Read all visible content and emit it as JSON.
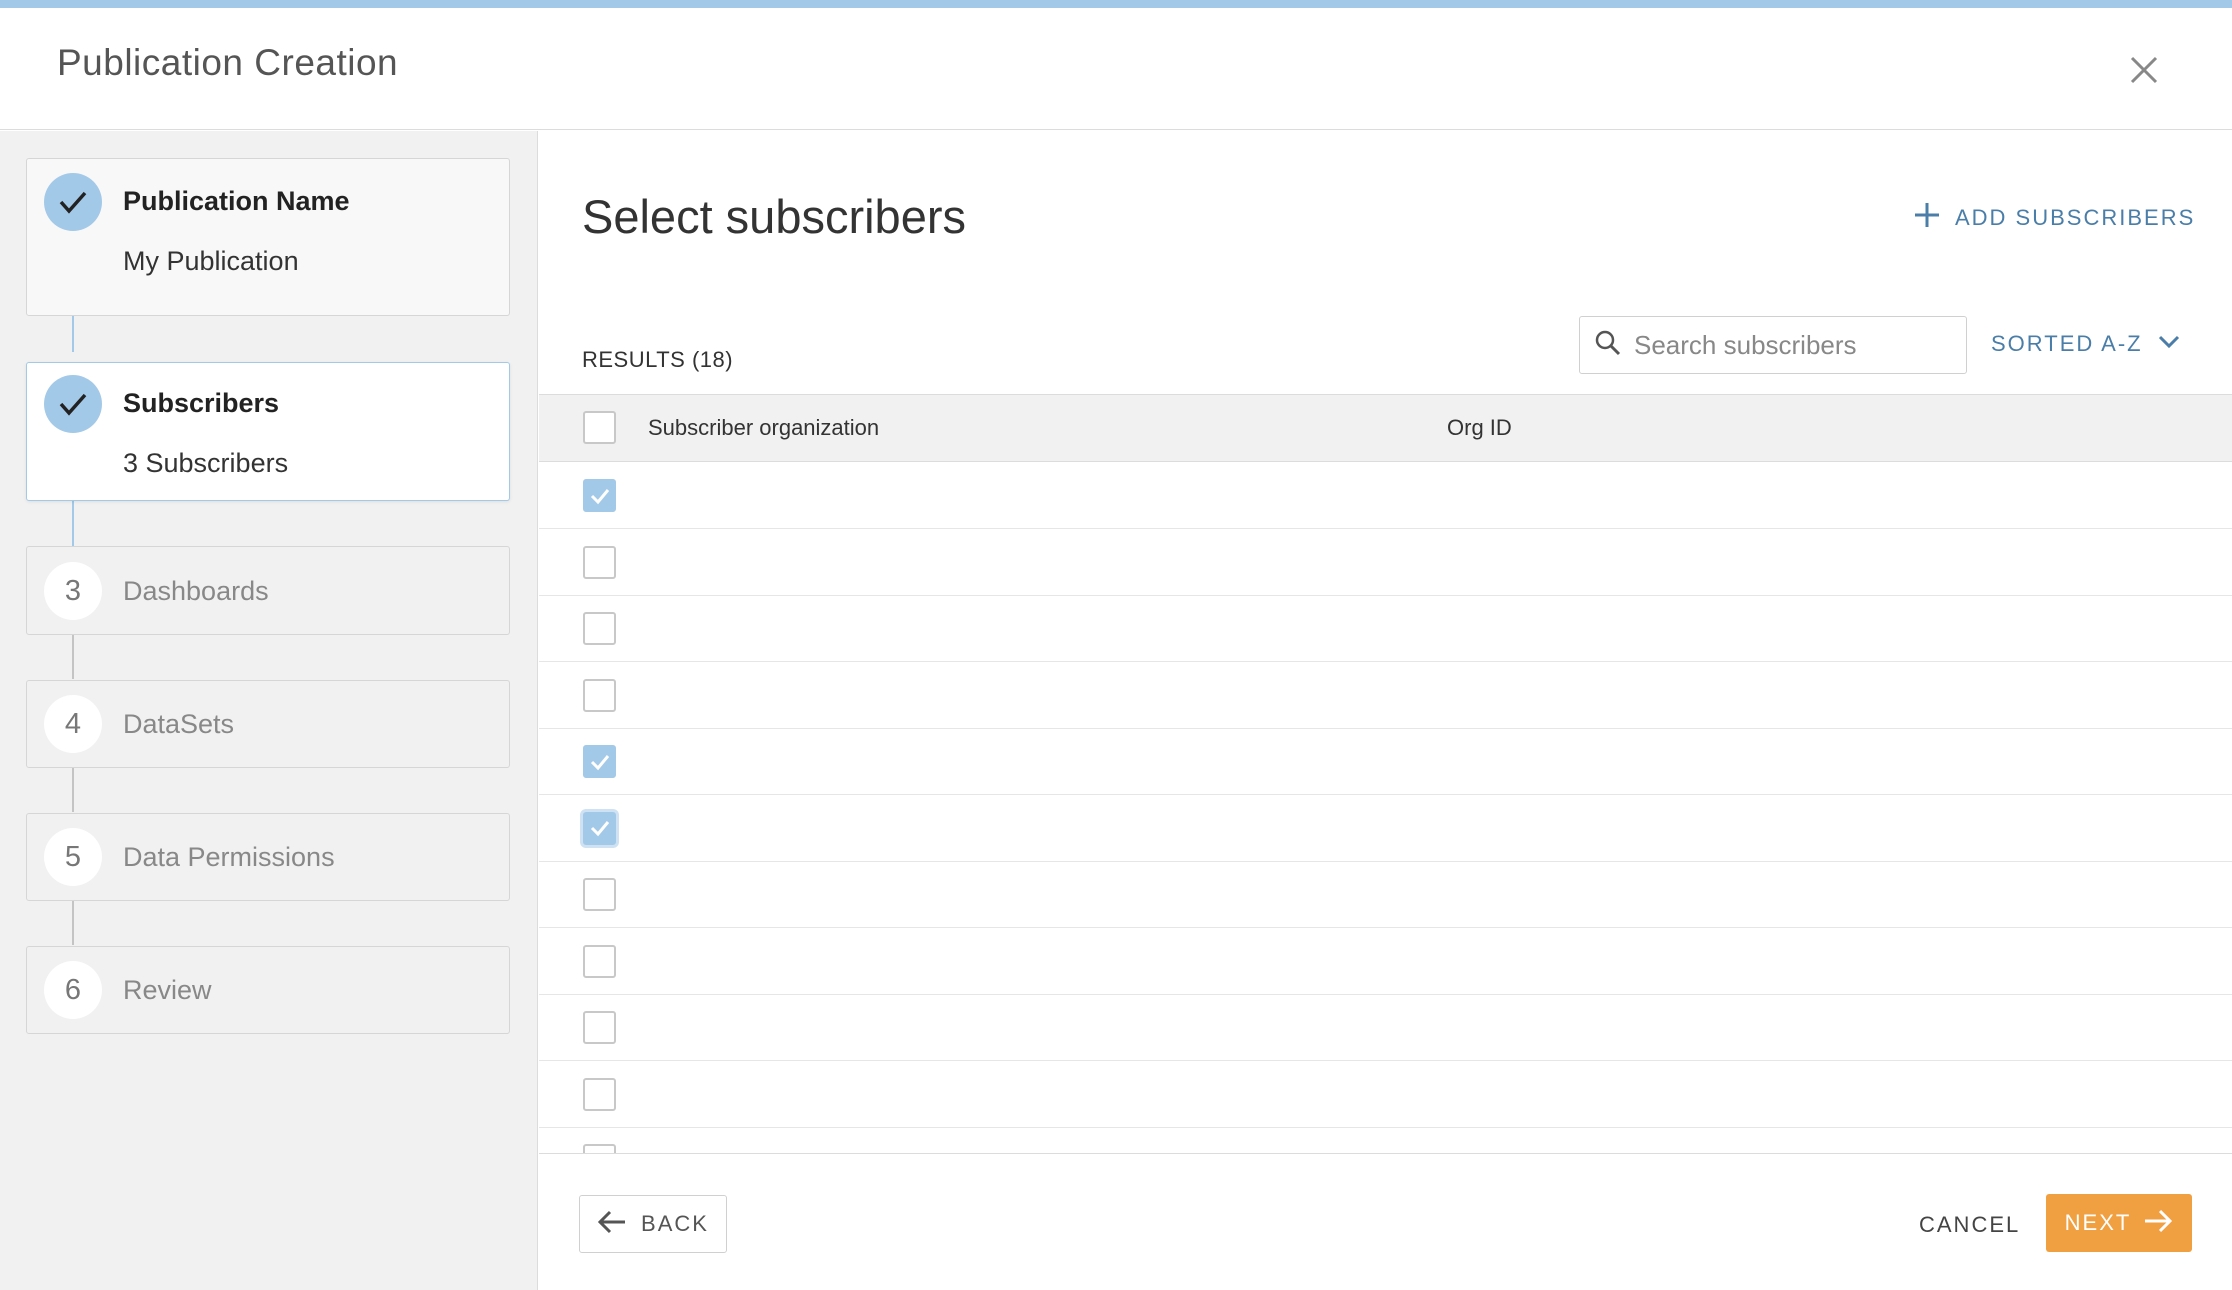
{
  "header": {
    "title": "Publication Creation",
    "close_icon": "close-icon"
  },
  "steps": [
    {
      "state": "done",
      "label": "Publication Name",
      "sub": "My Publication"
    },
    {
      "state": "current",
      "label": "Subscribers",
      "sub": "3 Subscribers"
    },
    {
      "state": "pending",
      "number": "3",
      "label": "Dashboards"
    },
    {
      "state": "pending",
      "number": "4",
      "label": "DataSets"
    },
    {
      "state": "pending",
      "number": "5",
      "label": "Data Permissions"
    },
    {
      "state": "pending",
      "number": "6",
      "label": "Review"
    }
  ],
  "main": {
    "heading": "Select subscribers",
    "add_label": "ADD SUBSCRIBERS",
    "results_label": "RESULTS (18)",
    "search_placeholder": "Search subscribers",
    "sort_label": "SORTED A-Z",
    "columns": {
      "org": "Subscriber organization",
      "org_id": "Org ID"
    }
  },
  "rows": [
    {
      "org": "",
      "checked": true
    },
    {
      "org": "",
      "checked": false
    },
    {
      "org": "",
      "checked": false
    },
    {
      "org": "",
      "checked": false
    },
    {
      "org": "",
      "checked": true
    },
    {
      "org": "",
      "checked": true,
      "focused": true
    },
    {
      "org": "",
      "checked": false
    },
    {
      "org": "",
      "checked": false
    },
    {
      "org": "",
      "checked": false
    },
    {
      "org": "",
      "checked": false
    },
    {
      "org": "",
      "checked": false
    }
  ],
  "footer": {
    "back_label": "BACK",
    "cancel_label": "CANCEL",
    "next_label": "NEXT"
  },
  "colors": {
    "accent": "#a3c9e8",
    "link": "#4a7ea8",
    "primary_button": "#f0a041"
  }
}
